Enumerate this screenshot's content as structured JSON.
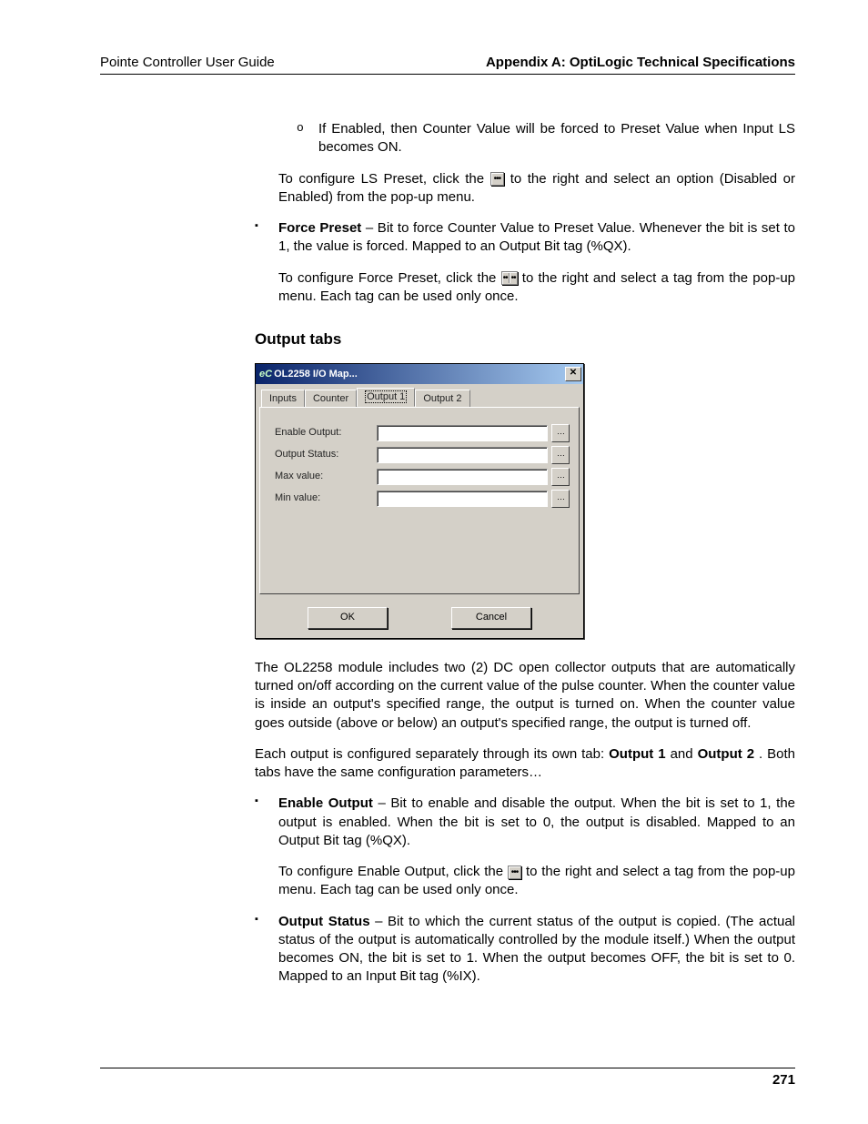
{
  "header": {
    "left": "Pointe Controller User Guide",
    "right": "Appendix A: OptiLogic Technical Specifications"
  },
  "content": {
    "sub_circle": "If Enabled, then Counter Value will be forced to Preset Value when Input LS becomes ON.",
    "ls_preset_cfg_a": "To configure LS Preset, click the ",
    "ls_preset_cfg_b": " to the right and select an option (Disabled or Enabled) from the pop-up menu.",
    "force_preset_label": "Force Preset",
    "force_preset_text": " – Bit to force Counter Value to Preset Value. Whenever the bit is set to 1, the value is forced. Mapped to an Output Bit tag (%QX).",
    "force_preset_cfg_a": "To configure Force Preset, click the ",
    "force_preset_cfg_b": " to the right and select a tag from the pop-up menu. Each tag can be used only once.",
    "heading_output_tabs": "Output tabs",
    "after_dialog_p1": "The OL2258 module includes two (2) DC open collector outputs that are automatically turned on/off according on the current value of the pulse counter. When the counter value is inside an output's specified range, the output is turned on. When the counter value goes outside (above or below) an output's specified range, the output is turned off.",
    "after_dialog_p2_a": "Each output is configured separately through its own tab: ",
    "after_dialog_p2_b": "Output 1",
    "after_dialog_p2_c": " and ",
    "after_dialog_p2_d": "Output 2",
    "after_dialog_p2_e": ". Both tabs have the same configuration parameters…",
    "enable_output_label": "Enable Output",
    "enable_output_text": " – Bit to enable and disable the output. When the bit is set to 1, the output is enabled. When the bit is set to 0, the output is disabled. Mapped to an Output Bit tag (%QX).",
    "enable_output_cfg_a": "To configure Enable Output, click the ",
    "enable_output_cfg_b": " to the right and select a tag from the pop-up menu. Each tag can be used only once.",
    "output_status_label": "Output Status",
    "output_status_text": " – Bit to which the current status of the output is copied. (The actual status of the output is automatically controlled by the module itself.) When the output becomes ON, the bit is set to 1. When the output becomes OFF, the bit is set to 0. Mapped to an Input Bit tag (%IX)."
  },
  "dialog": {
    "title_logo": "eC",
    "title": "OL2258 I/O Map...",
    "close": "✕",
    "tabs": {
      "inputs": "Inputs",
      "counter": "Counter",
      "output1": "Output 1",
      "output2": "Output 2"
    },
    "fields": {
      "enable_output": "Enable Output:",
      "output_status": "Output Status:",
      "max_value": "Max value:",
      "min_value": "Min value:"
    },
    "ellipsis": "…",
    "ok": "OK",
    "cancel": "Cancel"
  },
  "footer": {
    "page": "271"
  }
}
